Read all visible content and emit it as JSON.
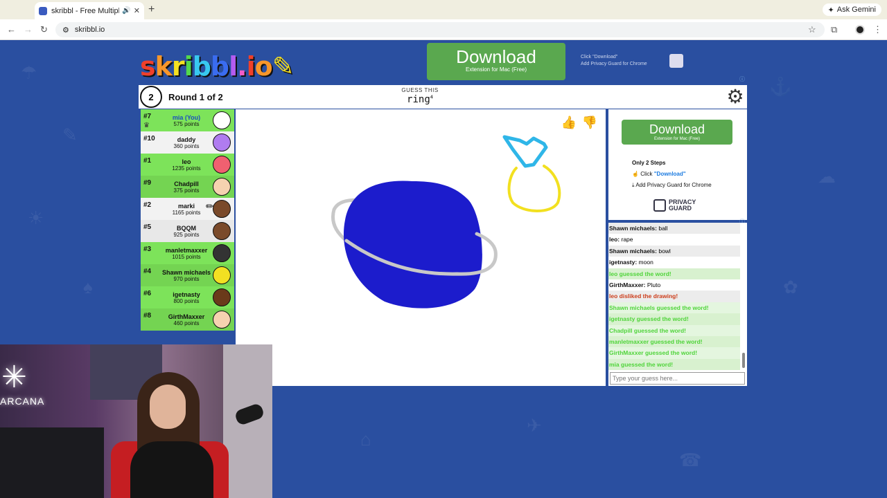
{
  "browser": {
    "tab_title": "skribbl - Free Multiplayer",
    "url": "skribbl.io",
    "ask_gemini": "Ask Gemini"
  },
  "header": {
    "logo": "skribbl.io",
    "download_big": "Download",
    "download_sub": "Extension for Mac (Free)",
    "ad_step1": "Click \"Download\"",
    "ad_step2": "Add Privacy Guard for Chrome"
  },
  "topbar": {
    "clock_value": "2",
    "round_text": "Round 1 of 2",
    "guess_label": "GUESS THIS",
    "word": "ring",
    "word_length": "4"
  },
  "players": [
    {
      "rank": "#7",
      "name": "mia (You)",
      "points": "575 points",
      "state": "guessed",
      "you": true,
      "avatar_color": "#ffffff",
      "crown": true
    },
    {
      "rank": "#10",
      "name": "daddy",
      "points": "360 points",
      "state": "notg",
      "avatar_color": "#b07cf0"
    },
    {
      "rank": "#1",
      "name": "leo",
      "points": "1235 points",
      "state": "guessed",
      "avatar_color": "#f06070"
    },
    {
      "rank": "#9",
      "name": "Chadpill",
      "points": "375 points",
      "state": "g2",
      "avatar_color": "#f5d2b0"
    },
    {
      "rank": "#2",
      "name": "marki",
      "points": "1165 points",
      "state": "notg",
      "avatar_color": "#7a4a2a",
      "drawing": true
    },
    {
      "rank": "#5",
      "name": "BQQM",
      "points": "925 points",
      "state": "notg2",
      "avatar_color": "#7a4a2a"
    },
    {
      "rank": "#3",
      "name": "manletmaxxer",
      "points": "1015 points",
      "state": "guessed",
      "avatar_color": "#333333"
    },
    {
      "rank": "#4",
      "name": "Shawn michaels",
      "points": "970 points",
      "state": "g2",
      "avatar_color": "#f2e022"
    },
    {
      "rank": "#6",
      "name": "igetnasty",
      "points": "800 points",
      "state": "guessed",
      "avatar_color": "#6a3a1a"
    },
    {
      "rank": "#8",
      "name": "GirthMaxxer",
      "points": "460 points",
      "state": "g2",
      "avatar_color": "#f5d2b0"
    }
  ],
  "side_ad": {
    "download_big": "Download",
    "download_sub": "Extension for Mac (Free)",
    "steps_title": "Only 2 Steps",
    "step1_prefix": "Click ",
    "step1_link": "\"Download\"",
    "step2": "Add Privacy Guard for Chrome",
    "brand_line1": "PRIVACY",
    "brand_line2": "GUARD"
  },
  "chat": [
    {
      "user": "Shawn michaels",
      "text": "ball",
      "type": "normal"
    },
    {
      "user": "leo",
      "text": "rape",
      "type": "normal"
    },
    {
      "user": "Shawn michaels",
      "text": "bowl",
      "type": "normal"
    },
    {
      "user": "igetnasty",
      "text": "moon",
      "type": "normal"
    },
    {
      "user": "",
      "text": "leo guessed the word!",
      "type": "green"
    },
    {
      "user": "GirthMaxxer",
      "text": "Pluto",
      "type": "normal"
    },
    {
      "user": "",
      "text": "leo disliked the drawing!",
      "type": "red"
    },
    {
      "user": "",
      "text": "Shawn michaels guessed the word!",
      "type": "green"
    },
    {
      "user": "",
      "text": "igetnasty guessed the word!",
      "type": "green"
    },
    {
      "user": "",
      "text": "Chadpill guessed the word!",
      "type": "green"
    },
    {
      "user": "",
      "text": "manletmaxxer guessed the word!",
      "type": "green"
    },
    {
      "user": "",
      "text": "GirthMaxxer guessed the word!",
      "type": "green"
    },
    {
      "user": "",
      "text": "mia guessed the word!",
      "type": "green"
    }
  ],
  "guess_input": {
    "placeholder": "Type your guess here..."
  },
  "webcam": {
    "neon_text": "ARCANA"
  },
  "colors": {
    "background": "#2a4fa0",
    "guessed": "#7de35a",
    "download": "#5aa84f",
    "planet": "#1c1ccc",
    "ring_gem": "#2fb6e8",
    "ring_band": "#f2e020"
  }
}
